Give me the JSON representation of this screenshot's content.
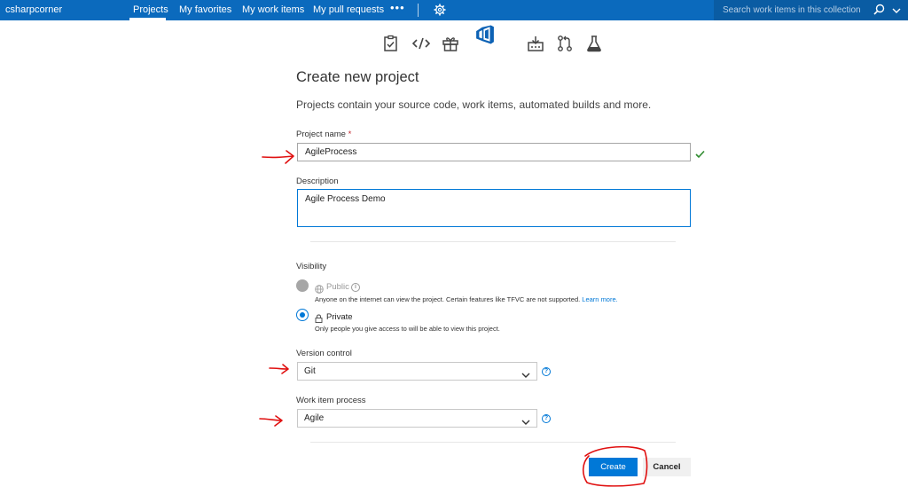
{
  "topbar": {
    "collection": "csharpcorner",
    "nav": [
      "Projects",
      "My favorites",
      "My work items",
      "My pull requests"
    ],
    "more": "•••",
    "search_placeholder": "Search work items in this collection"
  },
  "hub_icons": [
    "boards-icon",
    "code-icon",
    "release-icon",
    "vsts-logo-icon",
    "build-icon",
    "pull-request-icon",
    "test-icon"
  ],
  "form": {
    "title": "Create new project",
    "subtitle": "Projects contain your source code, work items, automated builds and more.",
    "name_label": "Project name",
    "required_mark": "*",
    "name_value": "AgileProcess",
    "description_label": "Description",
    "description_value": "Agile Process Demo",
    "visibility_label": "Visibility",
    "public_label": "Public",
    "public_desc": "Anyone on the internet can view the project. Certain features like TFVC are not supported.",
    "learn_more": "Learn more.",
    "private_label": "Private",
    "private_desc": "Only people you give access to will be able to view this project.",
    "version_control_label": "Version control",
    "version_control_value": "Git",
    "process_label": "Work item process",
    "process_value": "Agile",
    "create_label": "Create",
    "cancel_label": "Cancel"
  },
  "colors": {
    "brand_blue": "#0b6abd",
    "primary_button": "#0078d7",
    "annotation_red": "#e01010",
    "valid_check": "#2e8b2e"
  }
}
